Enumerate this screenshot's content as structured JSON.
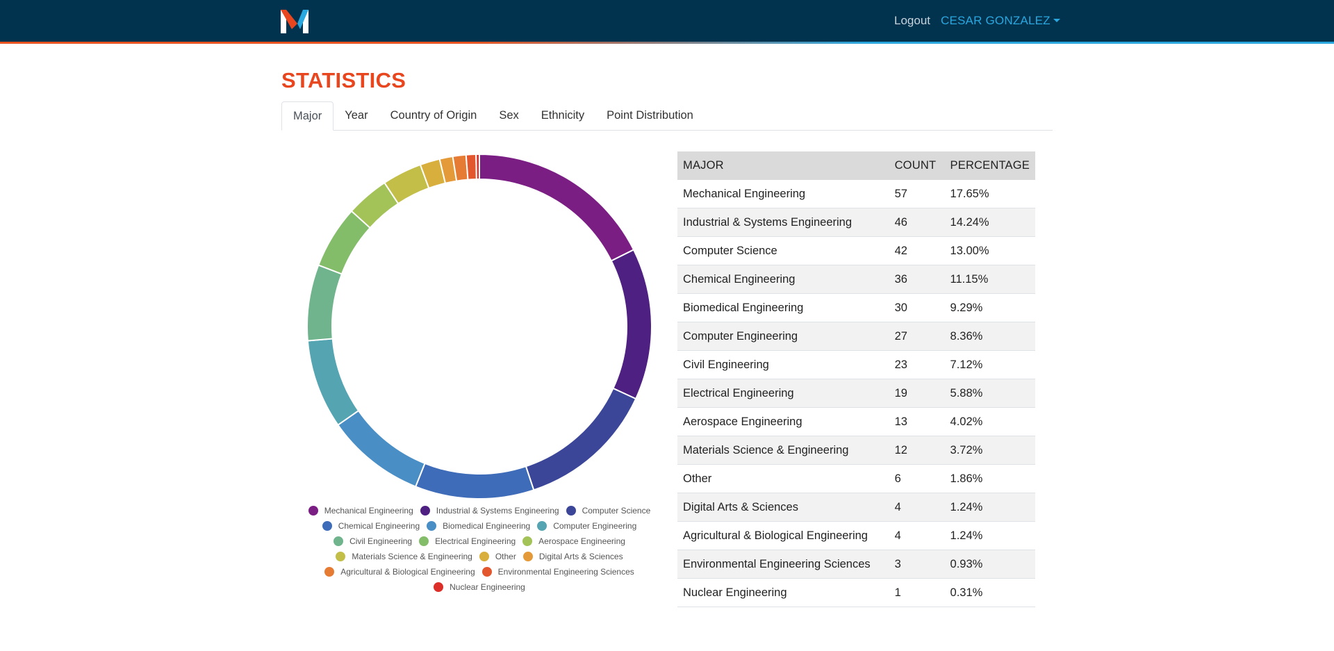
{
  "nav": {
    "logout_label": "Logout",
    "user_name": "CESAR GONZALEZ"
  },
  "page": {
    "title": "STATISTICS"
  },
  "tabs": [
    {
      "label": "Major",
      "active": true
    },
    {
      "label": "Year",
      "active": false
    },
    {
      "label": "Country of Origin",
      "active": false
    },
    {
      "label": "Sex",
      "active": false
    },
    {
      "label": "Ethnicity",
      "active": false
    },
    {
      "label": "Point Distribution",
      "active": false
    }
  ],
  "colors": {
    "navbar": "#01334f",
    "title": "#e8461f",
    "accent_blue": "#2aa7df",
    "accent_orange": "#e8531f"
  },
  "table": {
    "headers": [
      "MAJOR",
      "COUNT",
      "PERCENTAGE"
    ],
    "rows": [
      [
        "Mechanical Engineering",
        "57",
        "17.65%"
      ],
      [
        "Industrial & Systems Engineering",
        "46",
        "14.24%"
      ],
      [
        "Computer Science",
        "42",
        "13.00%"
      ],
      [
        "Chemical Engineering",
        "36",
        "11.15%"
      ],
      [
        "Biomedical Engineering",
        "30",
        "9.29%"
      ],
      [
        "Computer Engineering",
        "27",
        "8.36%"
      ],
      [
        "Civil Engineering",
        "23",
        "7.12%"
      ],
      [
        "Electrical Engineering",
        "19",
        "5.88%"
      ],
      [
        "Aerospace Engineering",
        "13",
        "4.02%"
      ],
      [
        "Materials Science & Engineering",
        "12",
        "3.72%"
      ],
      [
        "Other",
        "6",
        "1.86%"
      ],
      [
        "Digital Arts & Sciences",
        "4",
        "1.24%"
      ],
      [
        "Agricultural & Biological Engineering",
        "4",
        "1.24%"
      ],
      [
        "Environmental Engineering Sciences",
        "3",
        "0.93%"
      ],
      [
        "Nuclear Engineering",
        "1",
        "0.31%"
      ]
    ]
  },
  "chart_data": {
    "type": "pie",
    "style": "donut",
    "categories": [
      "Mechanical Engineering",
      "Industrial & Systems Engineering",
      "Computer Science",
      "Chemical Engineering",
      "Biomedical Engineering",
      "Computer Engineering",
      "Civil Engineering",
      "Electrical Engineering",
      "Aerospace Engineering",
      "Materials Science & Engineering",
      "Other",
      "Digital Arts & Sciences",
      "Agricultural & Biological Engineering",
      "Environmental Engineering Sciences",
      "Nuclear Engineering"
    ],
    "values": [
      57,
      46,
      42,
      36,
      30,
      27,
      23,
      19,
      13,
      12,
      6,
      4,
      4,
      3,
      1
    ],
    "colors": [
      "#7b1e84",
      "#4e2082",
      "#3c4698",
      "#3f6cb8",
      "#4a8ec6",
      "#55a4b2",
      "#6fb48c",
      "#84bd6a",
      "#a3c257",
      "#c2be47",
      "#d8ae3c",
      "#e49a38",
      "#e67c34",
      "#e3572e",
      "#dc2f2a"
    ],
    "legend_position": "bottom",
    "legend_rows": [
      [
        0,
        1,
        2
      ],
      [
        3,
        4,
        5
      ],
      [
        6,
        7,
        8
      ],
      [
        9,
        10,
        11
      ],
      [
        12,
        13
      ],
      [
        14
      ]
    ]
  }
}
